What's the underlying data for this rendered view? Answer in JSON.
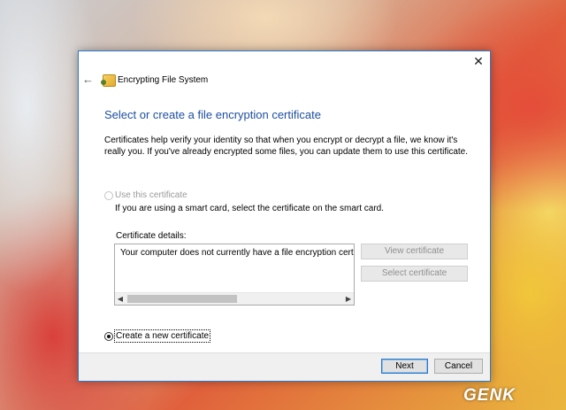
{
  "window": {
    "title": "Encrypting File System",
    "close_glyph": "✕",
    "back_glyph": "←",
    "app_icon": "encrypting-file-system-icon"
  },
  "main": {
    "heading": "Select or create a file encryption certificate",
    "intro": "Certificates help verify your identity so that when you encrypt or decrypt a file, we know it's really you. If you've already encrypted some files, you can update them to use this certificate.",
    "use_option": {
      "label": "Use this certificate",
      "selected": false,
      "enabled": false
    },
    "smart_card_note": "If you are using a smart card, select the certificate on the smart card.",
    "details_label": "Certificate details:",
    "details_text": "Your computer does not currently have a file encryption certificate.",
    "view_button": "View certificate",
    "select_button": "Select certificate",
    "create_option": {
      "label": "Create a new certificate",
      "selected": true,
      "enabled": true
    }
  },
  "footer": {
    "next_label": "Next",
    "cancel_label": "Cancel"
  },
  "watermark": "GENK"
}
